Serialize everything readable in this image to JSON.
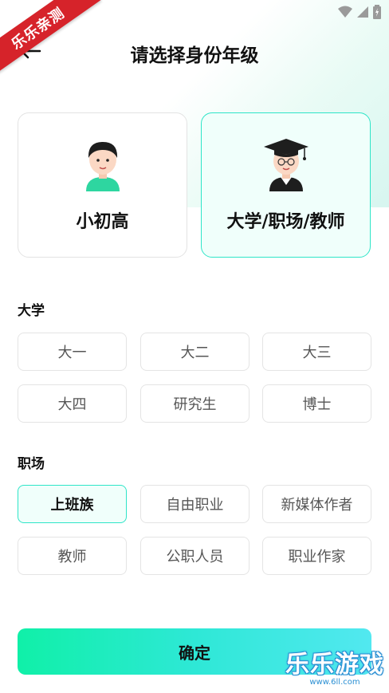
{
  "watermark_ribbon": "乐乐亲测",
  "header": {
    "title": "请选择身份年级"
  },
  "cards": [
    {
      "label": "小初高"
    },
    {
      "label": "大学/职场/教师"
    }
  ],
  "university": {
    "title": "大学",
    "options": [
      "大一",
      "大二",
      "大三",
      "大四",
      "研究生",
      "博士"
    ]
  },
  "workplace": {
    "title": "职场",
    "options": [
      "上班族",
      "自由职业",
      "新媒体作者",
      "教师",
      "公职人员",
      "职业作家"
    ],
    "selected": "上班族"
  },
  "confirm_label": "确定",
  "watermark": {
    "main": "乐乐游戏",
    "sub": "www.6ll.com"
  },
  "colors": {
    "accent": "#2ee5c8",
    "ribbon": "#d6232a",
    "button_start": "#10f0a8",
    "button_end": "#52e8f0"
  }
}
